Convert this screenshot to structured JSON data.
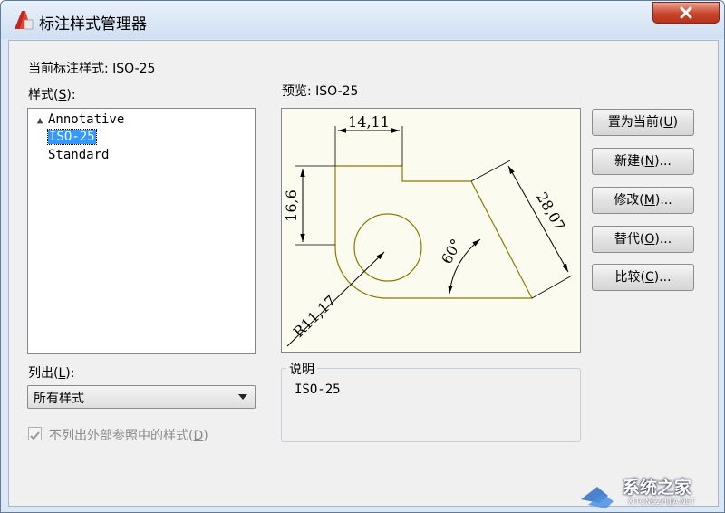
{
  "window": {
    "title": "标注样式管理器",
    "current_style_label": "当前标注样式: ISO-25"
  },
  "styles": {
    "label": "样式(",
    "hotkey": "S",
    "label_end": "):",
    "items": [
      {
        "label": "Annotative",
        "icon": "annotative-triangle-icon"
      },
      {
        "label": "ISO-25",
        "selected": true
      },
      {
        "label": "Standard"
      }
    ]
  },
  "preview": {
    "label": "预览: ISO-25",
    "dim_top": "14,11",
    "dim_left": "16,6",
    "dim_diag": "28,07",
    "dim_angle": "60°",
    "dim_radius": "R11,17",
    "line_color": "#8a7a00"
  },
  "list_filter": {
    "label": "列出(",
    "hotkey": "L",
    "label_end": "):",
    "selected": "所有样式"
  },
  "exclude_xref": {
    "label": "不列出外部参照中的样式(",
    "hotkey": "D",
    "label_end": ")",
    "checked": true,
    "disabled": true
  },
  "description": {
    "title": "说明",
    "value": "ISO-25"
  },
  "buttons": [
    {
      "name": "set-current-button",
      "label": "置为当前(",
      "hotkey": "U",
      "end": ")"
    },
    {
      "name": "new-button",
      "label": "新建(",
      "hotkey": "N",
      "end": ")..."
    },
    {
      "name": "modify-button",
      "label": "修改(",
      "hotkey": "M",
      "end": ")..."
    },
    {
      "name": "override-button",
      "label": "替代(",
      "hotkey": "O",
      "end": ")..."
    },
    {
      "name": "compare-button",
      "label": "比较(",
      "hotkey": "C",
      "end": ")..."
    }
  ],
  "watermark": {
    "text": "系统之家",
    "sub": "XITONGZHIJIA.NET"
  },
  "colors": {
    "accent": "#3399ff",
    "close": "#c8452a"
  }
}
